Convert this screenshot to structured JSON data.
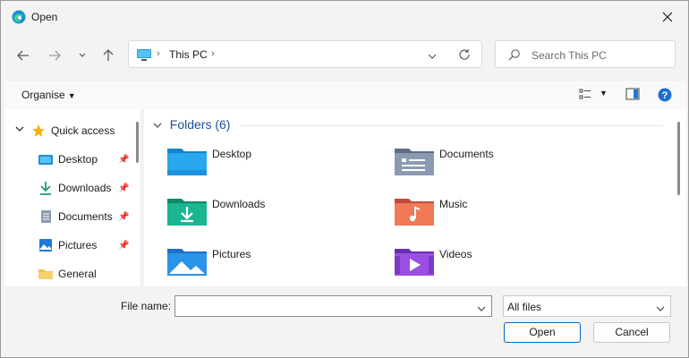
{
  "window": {
    "title": "Open"
  },
  "nav": {
    "breadcrumb": "This PC"
  },
  "search": {
    "placeholder": "Search This PC"
  },
  "toolbar": {
    "organise_label": "Organise",
    "help_glyph": "?"
  },
  "sidebar": {
    "items": [
      {
        "label": "Quick access",
        "icon": "star-icon",
        "pinned": false
      },
      {
        "label": "Desktop",
        "icon": "desktop-folder-icon",
        "pinned": true
      },
      {
        "label": "Downloads",
        "icon": "download-icon",
        "pinned": true
      },
      {
        "label": "Documents",
        "icon": "document-icon",
        "pinned": true
      },
      {
        "label": "Pictures",
        "icon": "pictures-icon",
        "pinned": true
      },
      {
        "label": "General",
        "icon": "folder-icon",
        "pinned": false
      }
    ]
  },
  "content": {
    "group_title": "Folders (6)",
    "folders": [
      {
        "name": "Desktop",
        "icon": "desktop-folder-icon"
      },
      {
        "name": "Documents",
        "icon": "documents-folder-icon"
      },
      {
        "name": "Downloads",
        "icon": "downloads-folder-icon"
      },
      {
        "name": "Music",
        "icon": "music-folder-icon"
      },
      {
        "name": "Pictures",
        "icon": "pictures-folder-icon"
      },
      {
        "name": "Videos",
        "icon": "videos-folder-icon"
      }
    ]
  },
  "footer": {
    "filename_label": "File name:",
    "filename_value": "",
    "filetype_value": "All files",
    "open_label": "Open",
    "cancel_label": "Cancel"
  },
  "colors": {
    "accent": "#0067c0",
    "link": "#1c4f99"
  }
}
